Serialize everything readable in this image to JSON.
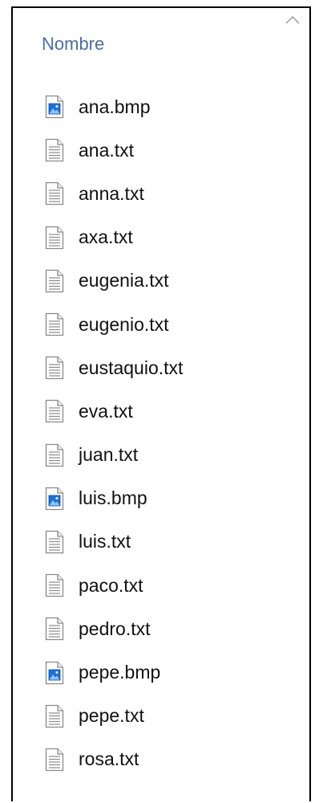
{
  "header": {
    "column_label": "Nombre",
    "sort_icon": "chevron-up-icon"
  },
  "files": [
    {
      "name": "ana.bmp",
      "type": "bmp",
      "icon": "image-file-icon"
    },
    {
      "name": "ana.txt",
      "type": "txt",
      "icon": "text-file-icon"
    },
    {
      "name": "anna.txt",
      "type": "txt",
      "icon": "text-file-icon"
    },
    {
      "name": "axa.txt",
      "type": "txt",
      "icon": "text-file-icon"
    },
    {
      "name": "eugenia.txt",
      "type": "txt",
      "icon": "text-file-icon"
    },
    {
      "name": "eugenio.txt",
      "type": "txt",
      "icon": "text-file-icon"
    },
    {
      "name": "eustaquio.txt",
      "type": "txt",
      "icon": "text-file-icon"
    },
    {
      "name": "eva.txt",
      "type": "txt",
      "icon": "text-file-icon"
    },
    {
      "name": "juan.txt",
      "type": "txt",
      "icon": "text-file-icon"
    },
    {
      "name": "luis.bmp",
      "type": "bmp",
      "icon": "image-file-icon"
    },
    {
      "name": "luis.txt",
      "type": "txt",
      "icon": "text-file-icon"
    },
    {
      "name": "paco.txt",
      "type": "txt",
      "icon": "text-file-icon"
    },
    {
      "name": "pedro.txt",
      "type": "txt",
      "icon": "text-file-icon"
    },
    {
      "name": "pepe.bmp",
      "type": "bmp",
      "icon": "image-file-icon"
    },
    {
      "name": "pepe.txt",
      "type": "txt",
      "icon": "text-file-icon"
    },
    {
      "name": "rosa.txt",
      "type": "txt",
      "icon": "text-file-icon"
    }
  ],
  "colors": {
    "header_text": "#4a6fa5",
    "file_text": "#111111",
    "image_icon_accent": "#1e6fd9"
  }
}
